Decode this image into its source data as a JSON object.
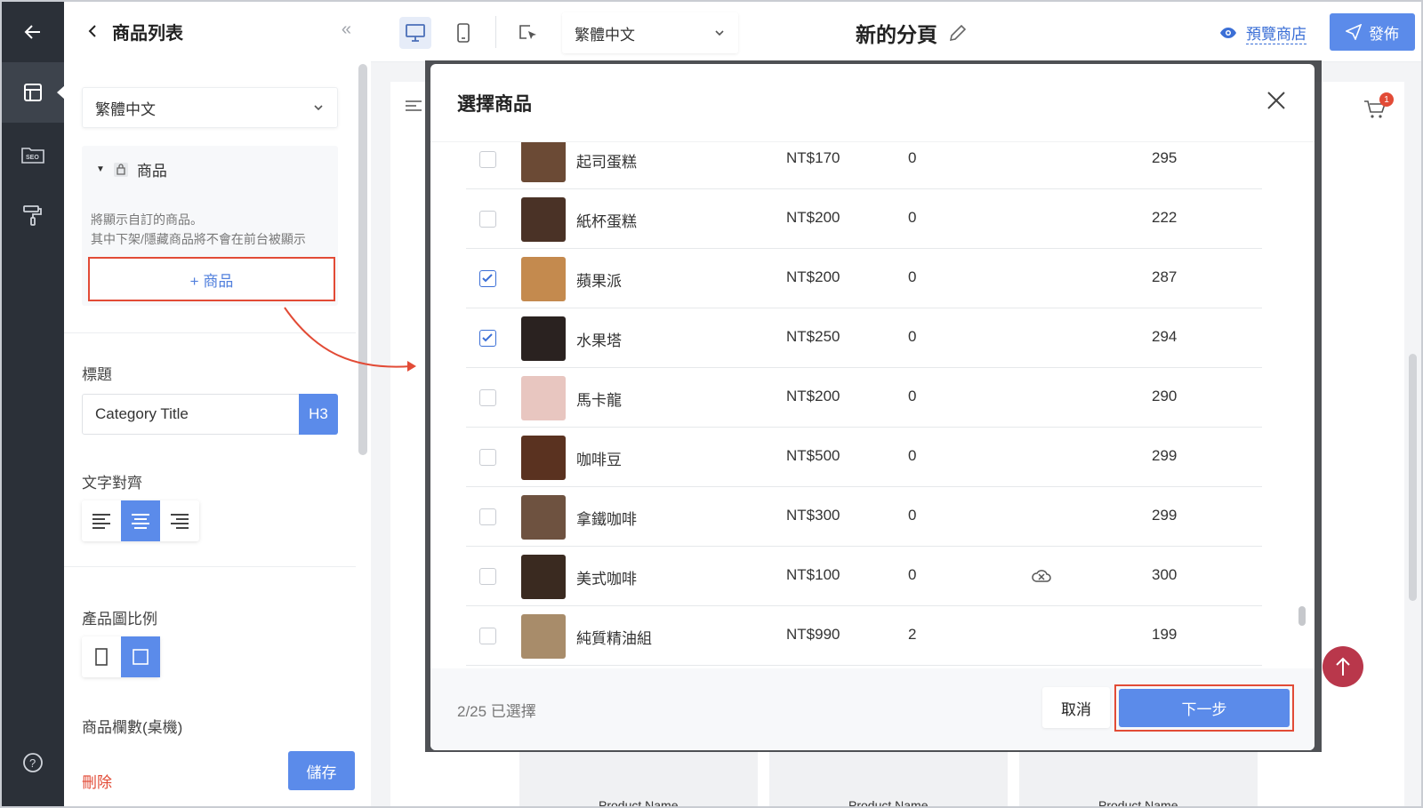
{
  "rail": {
    "items": [
      {
        "icon": "arrow-left-icon"
      },
      {
        "icon": "layout-icon",
        "active": true
      },
      {
        "icon": "seo-icon",
        "label": "SEO"
      },
      {
        "icon": "paint-roller-icon"
      },
      {
        "icon": "help-icon"
      }
    ]
  },
  "panel": {
    "title": "商品列表",
    "language": "繁體中文",
    "product_section": {
      "label": "商品",
      "description_line1": "將顯示自訂的商品。",
      "description_line2": "其中下架/隱藏商品將不會在前台被顯示",
      "add_label": "+ 商品"
    },
    "title_field": {
      "label": "標題",
      "value": "Category Title",
      "heading_level": "H3"
    },
    "text_align": {
      "label": "文字對齊",
      "selected": "center"
    },
    "image_ratio": {
      "label": "產品圖比例",
      "selected": "square"
    },
    "columns_label": "商品欄數(桌機)",
    "delete_label": "刪除",
    "save_label": "儲存"
  },
  "topbar": {
    "language": "繁體中文",
    "page_title": "新的分頁",
    "preview_label": "預覽商店",
    "publish_label": "發佈"
  },
  "store": {
    "cart_count": "1",
    "product_names": [
      "Product Name",
      "Product Name",
      "Product Name"
    ]
  },
  "modal": {
    "title": "選擇商品",
    "products": [
      {
        "name": "起司蛋糕",
        "price": "NT$170",
        "stock": "0",
        "count": "295",
        "checked": false,
        "thumb": "#6b4a35"
      },
      {
        "name": "紙杯蛋糕",
        "price": "NT$200",
        "stock": "0",
        "count": "222",
        "checked": false,
        "thumb": "#4a3226"
      },
      {
        "name": "蘋果派",
        "price": "NT$200",
        "stock": "0",
        "count": "287",
        "checked": true,
        "thumb": "#c48a4e"
      },
      {
        "name": "水果塔",
        "price": "NT$250",
        "stock": "0",
        "count": "294",
        "checked": true,
        "thumb": "#2a2220"
      },
      {
        "name": "馬卡龍",
        "price": "NT$200",
        "stock": "0",
        "count": "290",
        "checked": false,
        "thumb": "#e8c6c0"
      },
      {
        "name": "咖啡豆",
        "price": "NT$500",
        "stock": "0",
        "count": "299",
        "checked": false,
        "thumb": "#5a3220"
      },
      {
        "name": "拿鐵咖啡",
        "price": "NT$300",
        "stock": "0",
        "count": "299",
        "checked": false,
        "thumb": "#6e5240"
      },
      {
        "name": "美式咖啡",
        "price": "NT$100",
        "stock": "0",
        "count": "300",
        "checked": false,
        "thumb": "#3a2a20",
        "cloud_off": true
      },
      {
        "name": "純質精油組",
        "price": "NT$990",
        "stock": "2",
        "count": "199",
        "checked": false,
        "thumb": "#a88c6a"
      }
    ],
    "selected_count": "2/25 已選擇",
    "cancel_label": "取消",
    "next_label": "下一步"
  },
  "colors": {
    "accent": "#5b8bea",
    "highlight_border": "#e24b36",
    "rail_bg": "#2b3038"
  }
}
